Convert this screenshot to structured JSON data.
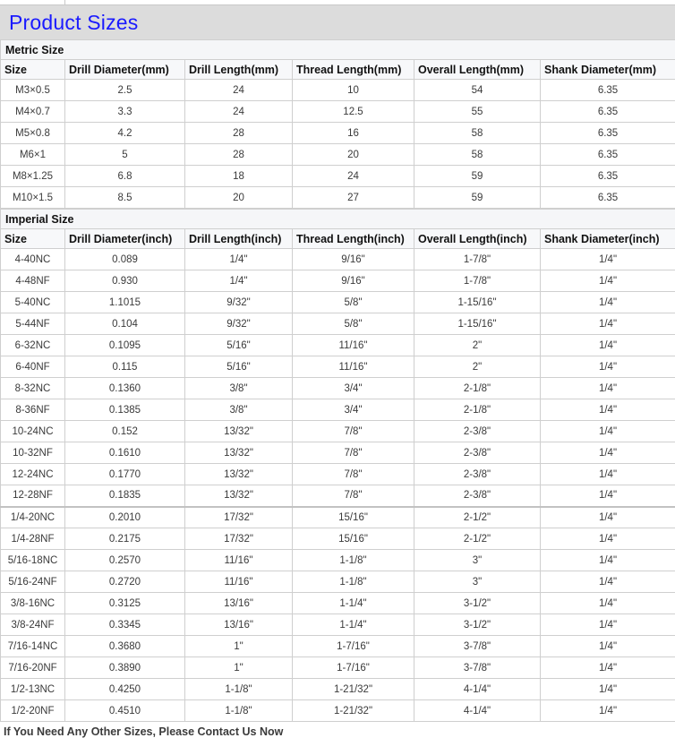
{
  "page": {
    "title": "Product Sizes",
    "footer_note": "If You Need Any Other Sizes, Please Contact Us Now"
  },
  "colors": {
    "title_text": "#1a1aff",
    "title_band_bg": "#dcdcdc",
    "header_bg": "#f7f8fa",
    "border": "#cfcfcf",
    "cell_text": "#3a3a3a"
  },
  "metric": {
    "section_label": "Metric Size",
    "columns": [
      "Size",
      "Drill Diameter(mm)",
      "Drill Length(mm)",
      "Thread Length(mm)",
      "Overall Length(mm)",
      "Shank Diameter(mm)"
    ],
    "rows": [
      [
        "M3×0.5",
        "2.5",
        "24",
        "10",
        "54",
        "6.35"
      ],
      [
        "M4×0.7",
        "3.3",
        "24",
        "12.5",
        "55",
        "6.35"
      ],
      [
        "M5×0.8",
        "4.2",
        "28",
        "16",
        "58",
        "6.35"
      ],
      [
        "M6×1",
        "5",
        "28",
        "20",
        "58",
        "6.35"
      ],
      [
        "M8×1.25",
        "6.8",
        "18",
        "24",
        "59",
        "6.35"
      ],
      [
        "M10×1.5",
        "8.5",
        "20",
        "27",
        "59",
        "6.35"
      ]
    ]
  },
  "imperial": {
    "section_label": "Imperial Size",
    "columns": [
      "Size",
      "Drill Diameter(inch)",
      "Drill Length(inch)",
      "Thread Length(inch)",
      "Overall Length(inch)",
      "Shank Diameter(inch)"
    ],
    "rows": [
      [
        "4-40NC",
        "0.089",
        "1/4\"",
        "9/16\"",
        "1-7/8\"",
        "1/4\""
      ],
      [
        "4-48NF",
        "0.930",
        "1/4\"",
        "9/16\"",
        "1-7/8\"",
        "1/4\""
      ],
      [
        "5-40NC",
        "1.1015",
        "9/32\"",
        "5/8\"",
        "1-15/16\"",
        "1/4\""
      ],
      [
        "5-44NF",
        "0.104",
        "9/32\"",
        "5/8\"",
        "1-15/16\"",
        "1/4\""
      ],
      [
        "6-32NC",
        "0.1095",
        "5/16\"",
        "11/16\"",
        "2\"",
        "1/4\""
      ],
      [
        "6-40NF",
        "0.115",
        "5/16\"",
        "11/16\"",
        "2\"",
        "1/4\""
      ],
      [
        "8-32NC",
        "0.1360",
        "3/8\"",
        "3/4\"",
        "2-1/8\"",
        "1/4\""
      ],
      [
        "8-36NF",
        "0.1385",
        "3/8\"",
        "3/4\"",
        "2-1/8\"",
        "1/4\""
      ],
      [
        "10-24NC",
        "0.152",
        "13/32\"",
        "7/8\"",
        "2-3/8\"",
        "1/4\""
      ],
      [
        "10-32NF",
        "0.1610",
        "13/32\"",
        "7/8\"",
        "2-3/8\"",
        "1/4\""
      ],
      [
        "12-24NC",
        "0.1770",
        "13/32\"",
        "7/8\"",
        "2-3/8\"",
        "1/4\""
      ],
      [
        "12-28NF",
        "0.1835",
        "13/32\"",
        "7/8\"",
        "2-3/8\"",
        "1/4\""
      ],
      [
        "1/4-20NC",
        "0.2010",
        "17/32\"",
        "15/16\"",
        "2-1/2\"",
        "1/4\""
      ],
      [
        "1/4-28NF",
        "0.2175",
        "17/32\"",
        "15/16\"",
        "2-1/2\"",
        "1/4\""
      ],
      [
        "5/16-18NC",
        "0.2570",
        "11/16\"",
        "1-1/8\"",
        "3\"",
        "1/4\""
      ],
      [
        "5/16-24NF",
        "0.2720",
        "11/16\"",
        "1-1/8\"",
        "3\"",
        "1/4\""
      ],
      [
        "3/8-16NC",
        "0.3125",
        "13/16\"",
        "1-1/4\"",
        "3-1/2\"",
        "1/4\""
      ],
      [
        "3/8-24NF",
        "0.3345",
        "13/16\"",
        "1-1/4\"",
        "3-1/2\"",
        "1/4\""
      ],
      [
        "7/16-14NC",
        "0.3680",
        "1\"",
        "1-7/16\"",
        "3-7/8\"",
        "1/4\""
      ],
      [
        "7/16-20NF",
        "0.3890",
        "1\"",
        "1-7/16\"",
        "3-7/8\"",
        "1/4\""
      ],
      [
        "1/2-13NC",
        "0.4250",
        "1-1/8\"",
        "1-21/32\"",
        "4-1/4\"",
        "1/4\""
      ],
      [
        "1/2-20NF",
        "0.4510",
        "1-1/8\"",
        "1-21/32\"",
        "4-1/4\"",
        "1/4\""
      ]
    ],
    "thick_divider_before_row_index": 12
  }
}
